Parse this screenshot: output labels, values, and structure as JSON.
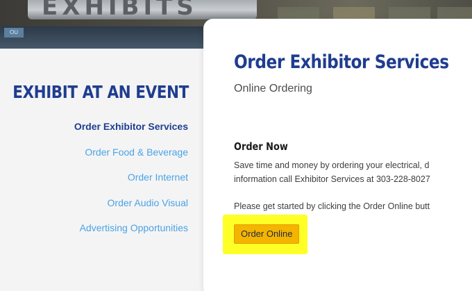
{
  "hero": {
    "sign_text": "EXHIBITS",
    "door_label": "OU"
  },
  "sidebar": {
    "heading": "EXHIBIT AT AN EVENT",
    "items": [
      {
        "label": "Order Exhibitor Services",
        "active": true
      },
      {
        "label": "Order Food & Beverage",
        "active": false
      },
      {
        "label": "Order Internet",
        "active": false
      },
      {
        "label": "Order Audio Visual",
        "active": false
      },
      {
        "label": "Advertising Opportunities",
        "active": false
      }
    ]
  },
  "main": {
    "title": "Order Exhibitor Services",
    "subtitle": "Online Ordering",
    "section_heading": "Order Now",
    "paragraph_line1": "Save time and money by ordering your electrical, d",
    "paragraph_line2": "information call Exhibitor Services at 303-228-8027",
    "paragraph_line3": "Please get started by clicking the Order Online butt",
    "button_label": "Order Online"
  },
  "colors": {
    "heading_navy": "#1f3d8f",
    "link_blue": "#4aa3e4",
    "button_gold": "#f4b400",
    "highlight_yellow": "#ffff28"
  }
}
